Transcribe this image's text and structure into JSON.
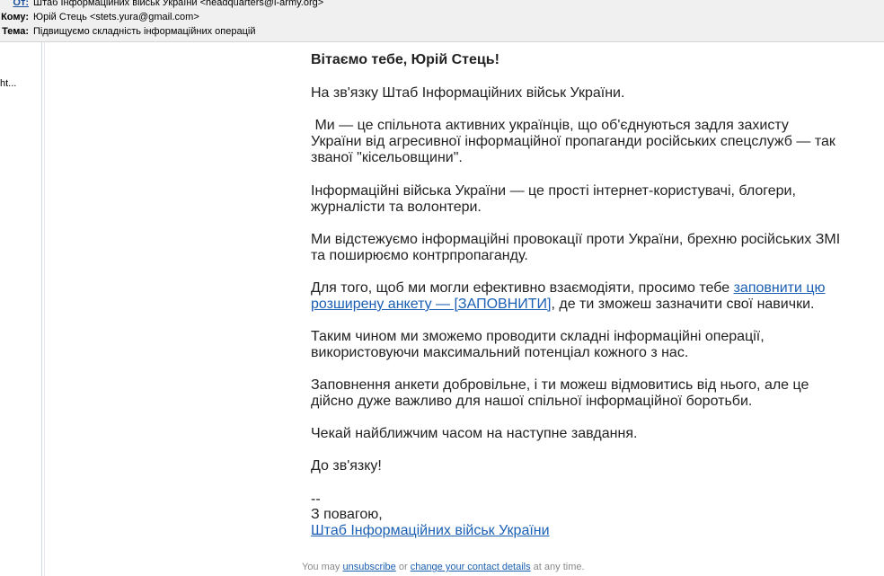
{
  "header": {
    "from_label": "От:",
    "from_value": "Штаб Інформаційних військ України <headquarters@i-army.org>",
    "to_label": "Кому:",
    "to_value": "Юрій Стець <stets.yura@gmail.com>",
    "subject_label": "Тема:",
    "subject_value": "Підвищуємо складність інформаційних операцій"
  },
  "sidebar": {
    "truncated_text": "ht..."
  },
  "message": {
    "greeting": "Вітаємо тебе, Юрій Стець!",
    "p1": "На зв'язку Штаб Інформаційних військ України.",
    "p2": " Ми — це спільнота активних українців, що об'єднуються задля захисту України від агресивної інформаційної пропаганди російських спецслужб — так званої \"кісельовщини\".",
    "p3": "Інформаційні війська України — це прості інтернет-користувачі, блогери, журналісти та волонтери.",
    "p4": "Ми відстежуємо інформаційні провокації проти України, брехню російських ЗМІ та поширюємо контрпропаганду.",
    "p5_before": "Для того, щоб ми могли ефективно взаємодіяти, просимо тебе ",
    "p5_link": "заповнити цю розширену анкету — [ЗАПОВНИТИ]",
    "p5_after": ", де ти зможеш зазначити свої навички.",
    "p6": "Таким чином ми зможемо проводити складні інформаційні операції, використовуючи максимальний потенціал кожного з нас.",
    "p7": "Заповнення анкети добровільне, і ти можеш відмовитись від нього, але це дійсно дуже важливо для нашої спільної інформаційної боротьби.",
    "p8": "Чекай найближчим часом на наступне завдання.",
    "p9": "До зв'язку!",
    "sig_dash": "--",
    "sig_regards": "З повагою,",
    "sig_link": "Штаб Інформаційних військ України"
  },
  "footer": {
    "text1": "You may ",
    "unsubscribe": "unsubscribe",
    "text2": " or ",
    "change": "change your contact details",
    "text3": " at any time."
  }
}
